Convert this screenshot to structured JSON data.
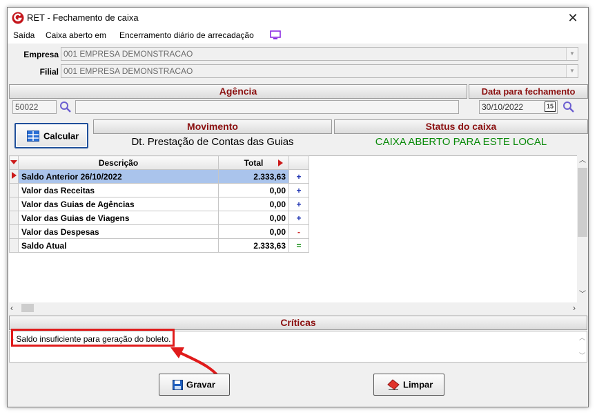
{
  "window": {
    "title": "RET - Fechamento de caixa"
  },
  "menu": {
    "items": [
      "Saída",
      "Caixa aberto em",
      "Encerramento diário de arrecadação"
    ]
  },
  "empresa": {
    "label": "Empresa",
    "value": "001 EMPRESA DEMONSTRACAO"
  },
  "filial": {
    "label": "Filial",
    "value": "001 EMPRESA DEMONSTRACAO"
  },
  "agencia": {
    "header": "Agência",
    "code": "50022",
    "name": ""
  },
  "data_fechamento": {
    "header": "Data para fechamento",
    "value": "30/10/2022",
    "cal_day": "15"
  },
  "calcular": {
    "label": "Calcular"
  },
  "movimento": {
    "header": "Movimento",
    "value": "Dt. Prestação de Contas das Guias"
  },
  "status": {
    "header": "Status do caixa",
    "value": "CAIXA ABERTO PARA ESTE LOCAL",
    "color": "#0a8a0a"
  },
  "grid": {
    "headers": {
      "descricao": "Descrição",
      "total": "Total"
    },
    "rows": [
      {
        "descricao": "Saldo Anterior  26/10/2022",
        "total": "2.333,63",
        "sign": "+"
      },
      {
        "descricao": "Valor das Receitas",
        "total": "0,00",
        "sign": "+"
      },
      {
        "descricao": "Valor das Guias de Agências",
        "total": "0,00",
        "sign": "+"
      },
      {
        "descricao": "Valor das Guias de Viagens",
        "total": "0,00",
        "sign": "+"
      },
      {
        "descricao": "Valor das Despesas",
        "total": "0,00",
        "sign": "-"
      },
      {
        "descricao": "Saldo Atual",
        "total": "2.333,63",
        "sign": "="
      }
    ]
  },
  "criticas": {
    "header": "Críticas",
    "message": "Saldo insuficiente para geração do boleto."
  },
  "buttons": {
    "gravar": "Gravar",
    "limpar": "Limpar"
  },
  "colors": {
    "header_text": "#8b1010",
    "plus": "#1a2fb0",
    "minus": "#cc1a1a",
    "equals": "#0a8a0a",
    "highlight": "#e01b1b"
  }
}
